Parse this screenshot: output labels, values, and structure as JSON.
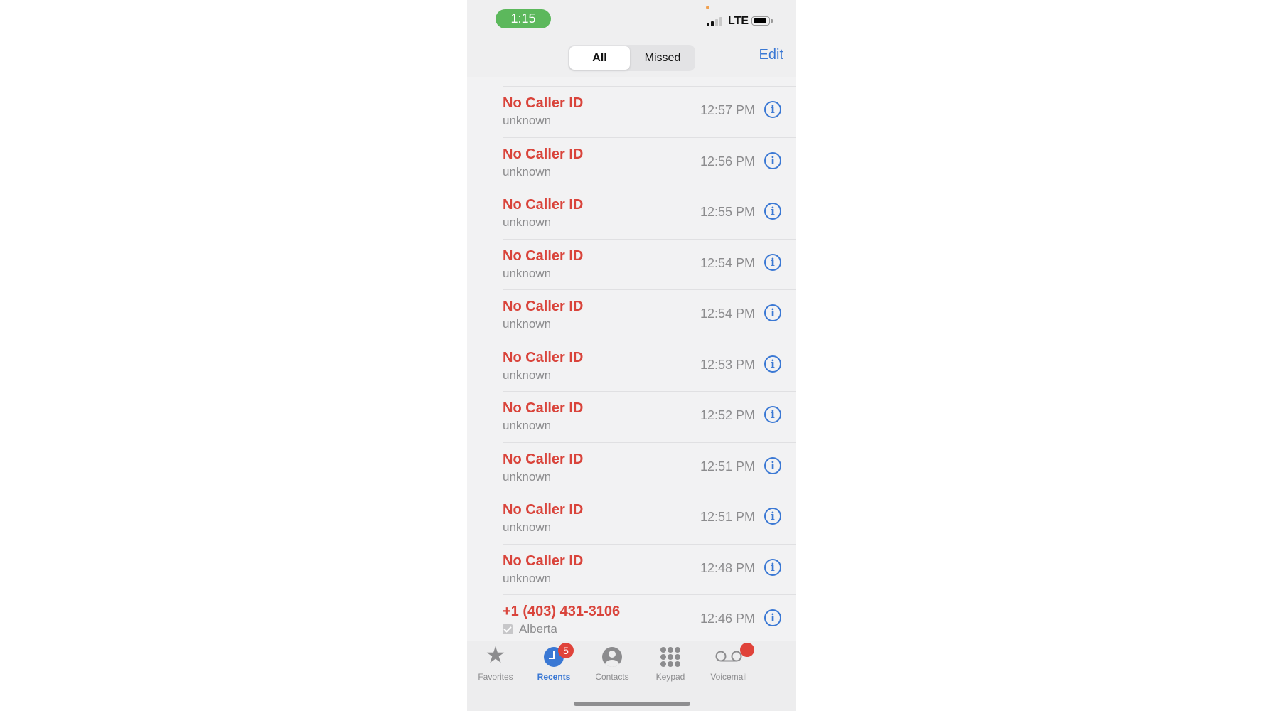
{
  "status_bar": {
    "time": "1:15",
    "network": "LTE"
  },
  "header": {
    "segments": [
      {
        "label": "All",
        "selected": true
      },
      {
        "label": "Missed",
        "selected": false
      }
    ],
    "edit_label": "Edit"
  },
  "calls": [
    {
      "name": "No Caller ID",
      "detail": "unknown",
      "time": "12:57 PM",
      "verified": false
    },
    {
      "name": "No Caller ID",
      "detail": "unknown",
      "time": "12:56 PM",
      "verified": false
    },
    {
      "name": "No Caller ID",
      "detail": "unknown",
      "time": "12:55 PM",
      "verified": false
    },
    {
      "name": "No Caller ID",
      "detail": "unknown",
      "time": "12:54 PM",
      "verified": false
    },
    {
      "name": "No Caller ID",
      "detail": "unknown",
      "time": "12:54 PM",
      "verified": false
    },
    {
      "name": "No Caller ID",
      "detail": "unknown",
      "time": "12:53 PM",
      "verified": false
    },
    {
      "name": "No Caller ID",
      "detail": "unknown",
      "time": "12:52 PM",
      "verified": false
    },
    {
      "name": "No Caller ID",
      "detail": "unknown",
      "time": "12:51 PM",
      "verified": false
    },
    {
      "name": "No Caller ID",
      "detail": "unknown",
      "time": "12:51 PM",
      "verified": false
    },
    {
      "name": "No Caller ID",
      "detail": "unknown",
      "time": "12:48 PM",
      "verified": false
    },
    {
      "name": "+1 (403) 431-3106",
      "detail": "Alberta",
      "time": "12:46 PM",
      "verified": true
    }
  ],
  "info_icon": "i",
  "tabbar": {
    "tabs": [
      {
        "label": "Favorites",
        "icon": "star-icon"
      },
      {
        "label": "Recents",
        "icon": "clock-icon",
        "badge": "5",
        "active": true
      },
      {
        "label": "Contacts",
        "icon": "person-circle-icon"
      },
      {
        "label": "Keypad",
        "icon": "keypad-icon"
      },
      {
        "label": "Voicemail",
        "icon": "voicemail-icon"
      }
    ],
    "favorites_glyph": "★"
  },
  "colors": {
    "missed_call": "#d9443b",
    "accent": "#3a78d4",
    "badge": "#e0433a",
    "time_pill": "#5cb85c"
  }
}
